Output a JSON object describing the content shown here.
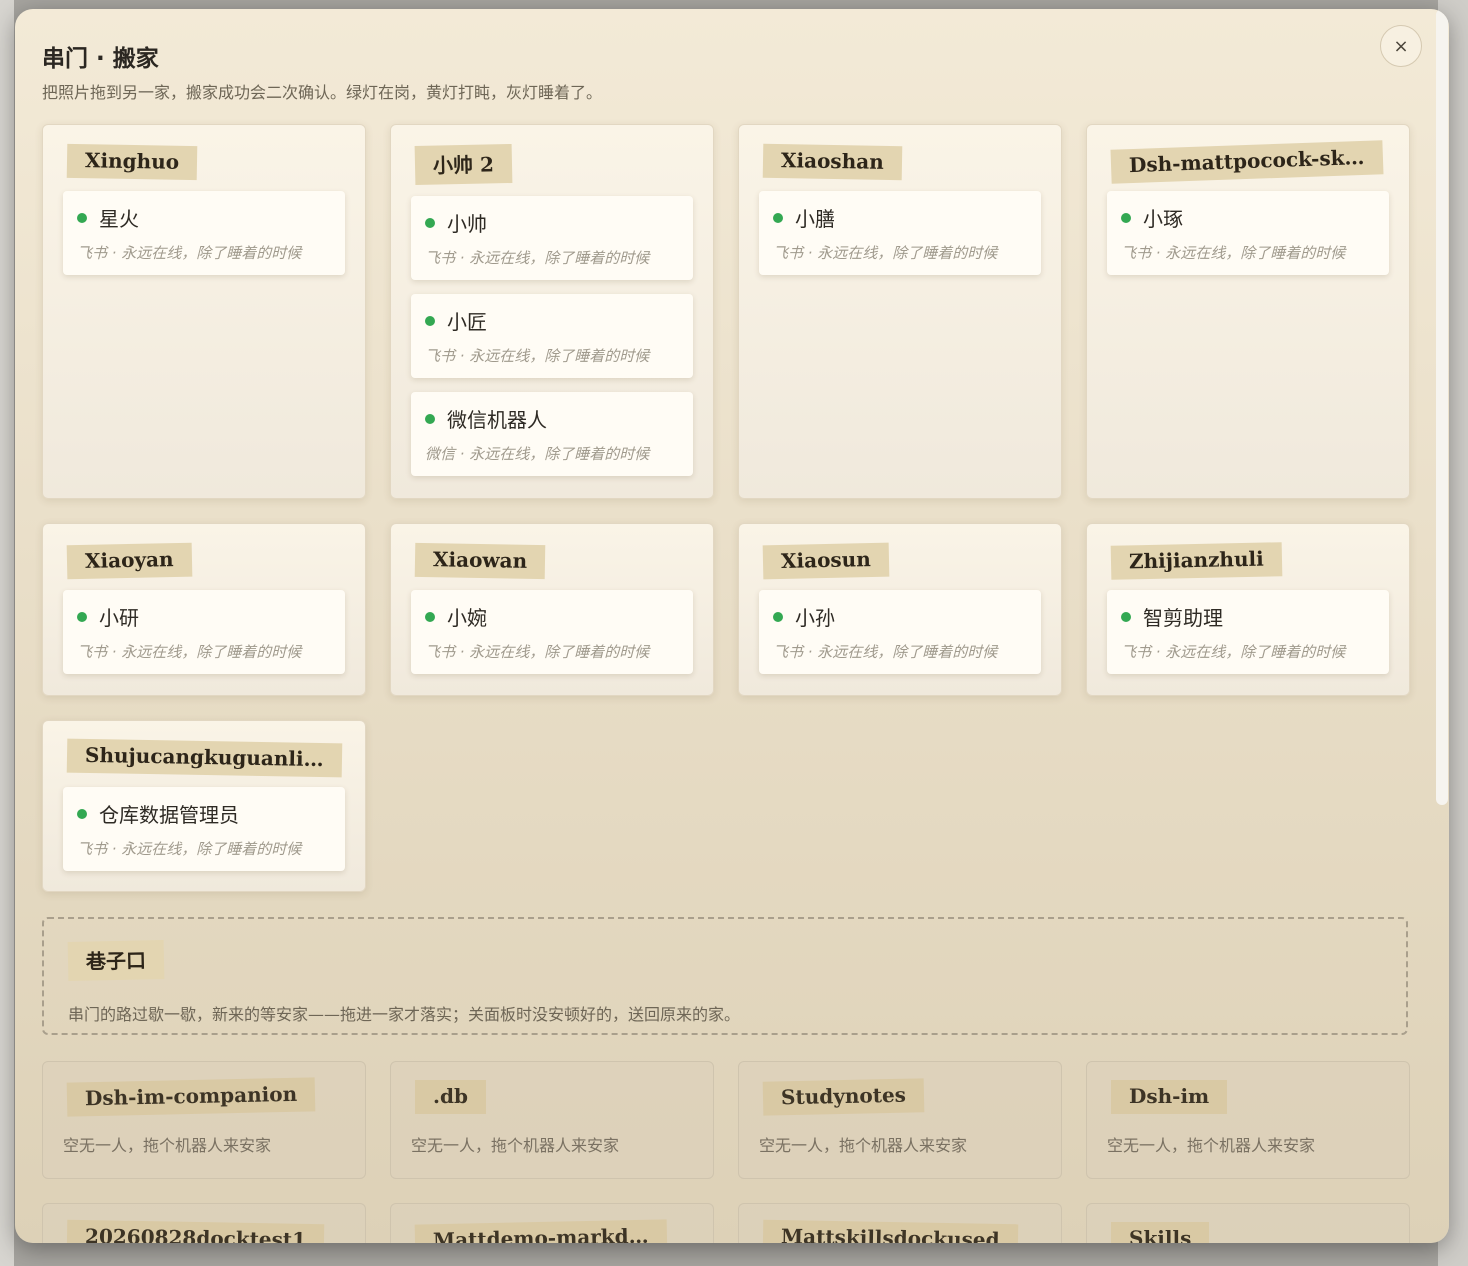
{
  "modal": {
    "title": "串门 · 搬家",
    "subtitle": "把照片拖到另一家，搬家成功会二次确认。绿灯在岗，黄灯打盹，灰灯睡着了。",
    "close_label": "×"
  },
  "homes": [
    {
      "name": "Xinghuo",
      "bots": [
        {
          "name": "星火",
          "meta": "飞书 · 永远在线，除了睡着的时候"
        }
      ]
    },
    {
      "name": "小帅 2",
      "bots": [
        {
          "name": "小帅",
          "meta": "飞书 · 永远在线，除了睡着的时候"
        },
        {
          "name": "小匠",
          "meta": "飞书 · 永远在线，除了睡着的时候"
        },
        {
          "name": "微信机器人",
          "meta": "微信 · 永远在线，除了睡着的时候"
        }
      ]
    },
    {
      "name": "Xiaoshan",
      "bots": [
        {
          "name": "小膳",
          "meta": "飞书 · 永远在线，除了睡着的时候"
        }
      ]
    },
    {
      "name": "Dsh-mattpocock-sk…",
      "bots": [
        {
          "name": "小琢",
          "meta": "飞书 · 永远在线，除了睡着的时候"
        }
      ]
    },
    {
      "name": "Xiaoyan",
      "bots": [
        {
          "name": "小研",
          "meta": "飞书 · 永远在线，除了睡着的时候"
        }
      ]
    },
    {
      "name": "Xiaowan",
      "bots": [
        {
          "name": "小婉",
          "meta": "飞书 · 永远在线，除了睡着的时候"
        }
      ]
    },
    {
      "name": "Xiaosun",
      "bots": [
        {
          "name": "小孙",
          "meta": "飞书 · 永远在线，除了睡着的时候"
        }
      ]
    },
    {
      "name": "Zhijianzhuli",
      "bots": [
        {
          "name": "智剪助理",
          "meta": "飞书 · 永远在线，除了睡着的时候"
        }
      ]
    },
    {
      "name": "Shujucangkuguanli…",
      "bots": [
        {
          "name": "仓库数据管理员",
          "meta": "飞书 · 永远在线，除了睡着的时候"
        }
      ]
    }
  ],
  "lane": {
    "name": "巷子口",
    "description": "串门的路过歇一歇，新来的等安家——拖进一家才落实；关面板时没安顿好的，送回原来的家。"
  },
  "empty_homes": [
    {
      "name": "Dsh-im-companion",
      "text": "空无一人，拖个机器人来安家"
    },
    {
      "name": ".db",
      "text": "空无一人，拖个机器人来安家"
    },
    {
      "name": "Studynotes",
      "text": "空无一人，拖个机器人来安家"
    },
    {
      "name": "Dsh-im",
      "text": "空无一人，拖个机器人来安家"
    },
    {
      "name": "20260828docktest1",
      "text": ""
    },
    {
      "name": "Mattdemo-markd…",
      "text": ""
    },
    {
      "name": "Mattskillsdockused",
      "text": ""
    },
    {
      "name": "Skills",
      "text": ""
    }
  ],
  "colors": {
    "status_online": "#33a852",
    "tag_bg": "#e3d5b1",
    "modal_bg": "#f3ead7"
  }
}
